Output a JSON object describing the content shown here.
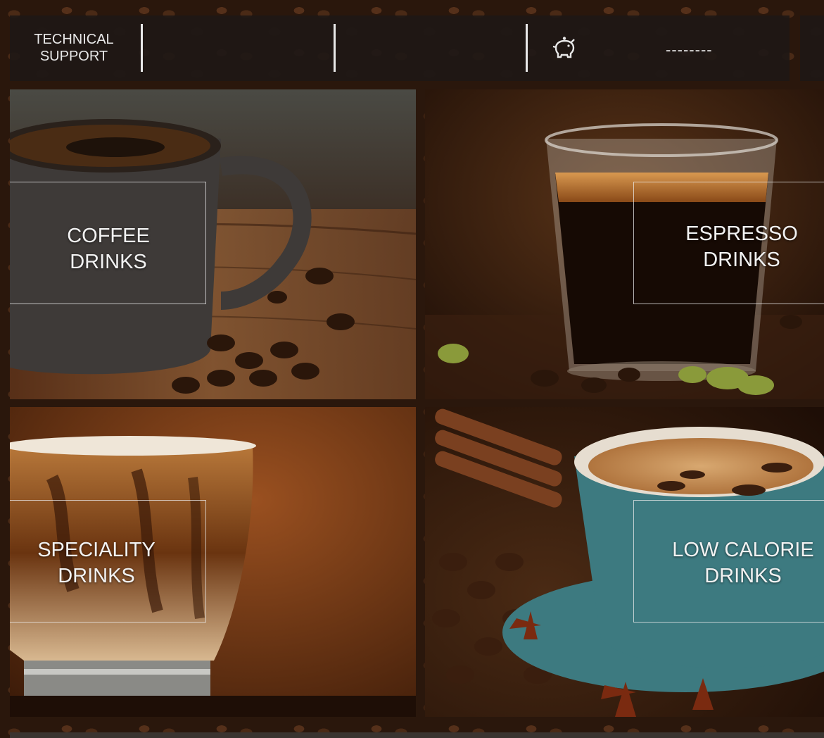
{
  "header": {
    "tech_support_label": "TECHNICAL SUPPORT",
    "balance_text": "--------",
    "balance_icon": "piggy-bank-icon"
  },
  "tiles": [
    {
      "id": "coffee",
      "label": "COFFEE DRINKS"
    },
    {
      "id": "espresso",
      "label": "ESPRESSO DRINKS"
    },
    {
      "id": "speciality",
      "label": "SPECIALITY DRINKS"
    },
    {
      "id": "low-calorie",
      "label": "LOW CALORIE DRINKS"
    }
  ],
  "colors": {
    "bar": "#1e1816",
    "text": "#e8e8e8",
    "coffee_bg": "#3b2a20",
    "espresso_bg": "#2c1a10",
    "speciality_bg": "#6a3614",
    "low_calorie_cup": "#3d7a80"
  }
}
